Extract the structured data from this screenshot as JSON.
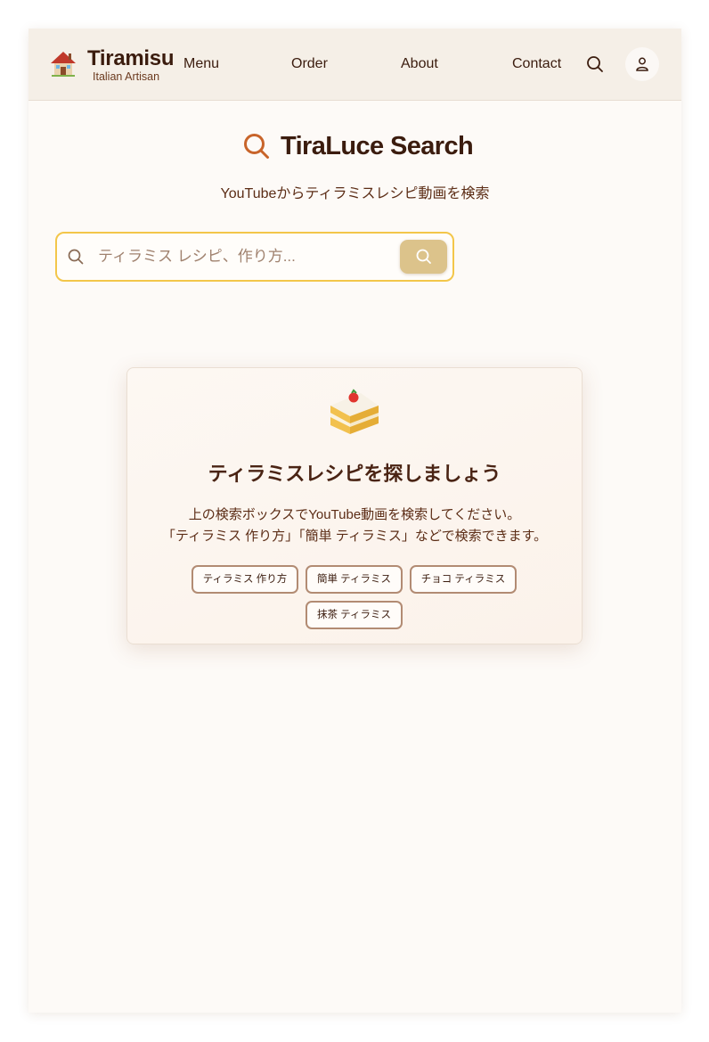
{
  "header": {
    "brand_title": "Tiramisu",
    "brand_subtitle": "Italian Artisan",
    "nav": {
      "menu": "Menu",
      "order": "Order",
      "about": "About",
      "contact": "Contact"
    },
    "icons": {
      "logo": "house-icon",
      "search": "search-icon",
      "account": "user-icon"
    }
  },
  "hero": {
    "title": "TiraLuce Search",
    "subtitle": "YouTubeからティラミスレシピ動画を検索",
    "icon": "search-icon"
  },
  "search": {
    "placeholder": "ティラミス レシピ、作り方...",
    "value": "",
    "button_icon": "search-icon"
  },
  "empty_state": {
    "icon": "cake-slice-icon",
    "title": "ティラミスレシピを探しましょう",
    "description_line1": "上の検索ボックスでYouTube動画を検索してください。",
    "description_line2": "「ティラミス 作り方」「簡単 ティラミス」などで検索できます。",
    "suggestions": [
      "ティラミス 作り方",
      "簡単 ティラミス",
      "チョコ ティラミス",
      "抹茶 ティラミス"
    ]
  },
  "colors": {
    "accent_orange": "#c8642a",
    "search_border": "#f3c64a",
    "search_button": "#dcc38b",
    "header_bg": "#f5efe7",
    "text_brown": "#3b1c0e"
  }
}
